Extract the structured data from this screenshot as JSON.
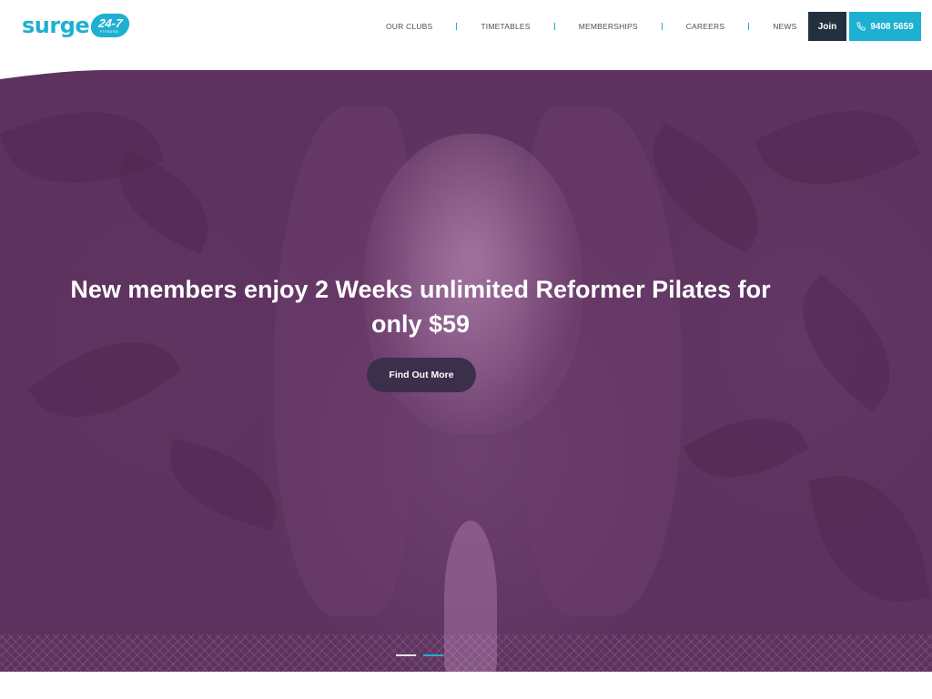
{
  "brand": {
    "logo_text": "surge",
    "logo_badge": "24-7",
    "logo_sub": "FITNESS",
    "accent_color": "#1eb0d0",
    "dark_color": "#223040"
  },
  "nav": {
    "items": [
      {
        "label": "OUR CLUBS"
      },
      {
        "label": "TIMETABLES"
      },
      {
        "label": "MEMBERSHIPS"
      },
      {
        "label": "CAREERS"
      },
      {
        "label": "NEWS"
      }
    ]
  },
  "actions": {
    "join_label": "Join",
    "phone_label": "9408 5659",
    "phone_icon": "phone-icon"
  },
  "hero": {
    "headline": "New members enjoy 2 Weeks unlimited Reformer Pilates for only $59",
    "cta_label": "Find Out More",
    "overlay_color": "#5e325f",
    "slides": 2,
    "active_slide": 2
  }
}
